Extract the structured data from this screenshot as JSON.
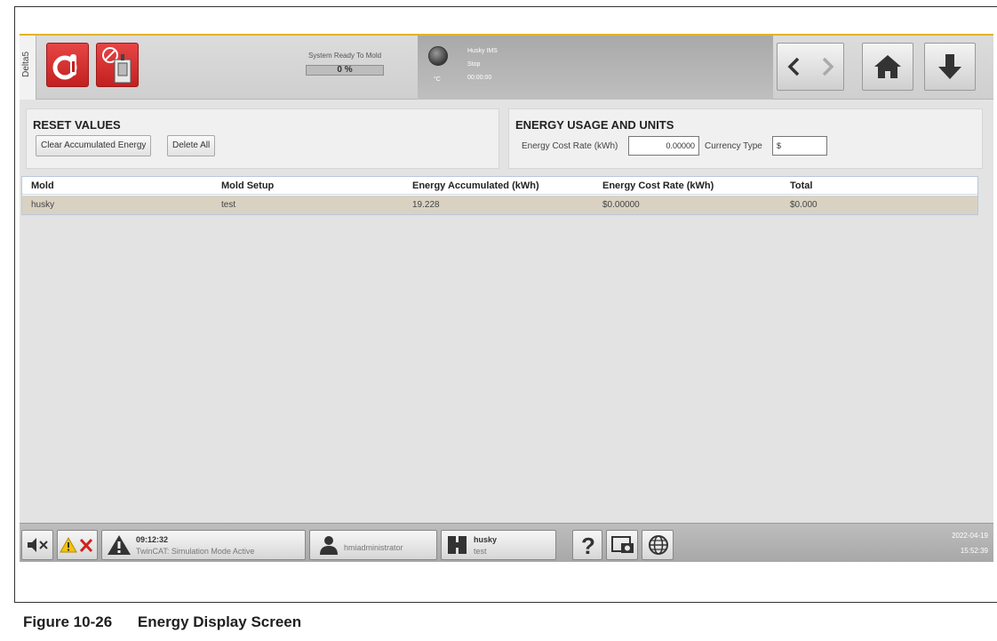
{
  "header": {
    "side_tab": "Delta5",
    "status_title": "System Ready To Mold",
    "progress_value": 0,
    "progress_label": "0 %",
    "temp_unit": "°C",
    "ims_title": "Husky IMS",
    "ims_state": "Stop",
    "ims_time": "00:00:00"
  },
  "reset_panel": {
    "title": "RESET VALUES",
    "clear_label": "Clear Accumulated Energy",
    "delete_label": "Delete All"
  },
  "energy_panel": {
    "title": "ENERGY USAGE AND UNITS",
    "rate_label": "Energy Cost Rate (kWh)",
    "rate_value": "0.00000",
    "currency_label": "Currency Type",
    "currency_value": "$"
  },
  "table": {
    "headers": [
      "Mold",
      "Mold Setup",
      "Energy Accumulated (kWh)",
      "Energy Cost Rate (kWh)",
      "Total"
    ],
    "rows": [
      [
        "husky",
        "test",
        "19.228",
        "$0.00000",
        "$0.000"
      ]
    ]
  },
  "footer": {
    "alarm_time": "09:12:32",
    "alarm_message": "TwinCAT: Simulation Mode Active",
    "user": "hmiadministrator",
    "mold_name": "husky",
    "mold_setup": "test",
    "date": "2022-04-19",
    "time": "15:52:39"
  },
  "caption": {
    "number": "Figure 10-26",
    "title": "Energy Display Screen"
  },
  "colors": {
    "accent_gold": "#e3b22c",
    "alarm_red": "#d02020",
    "row_highlight": "#d9d2c3"
  }
}
